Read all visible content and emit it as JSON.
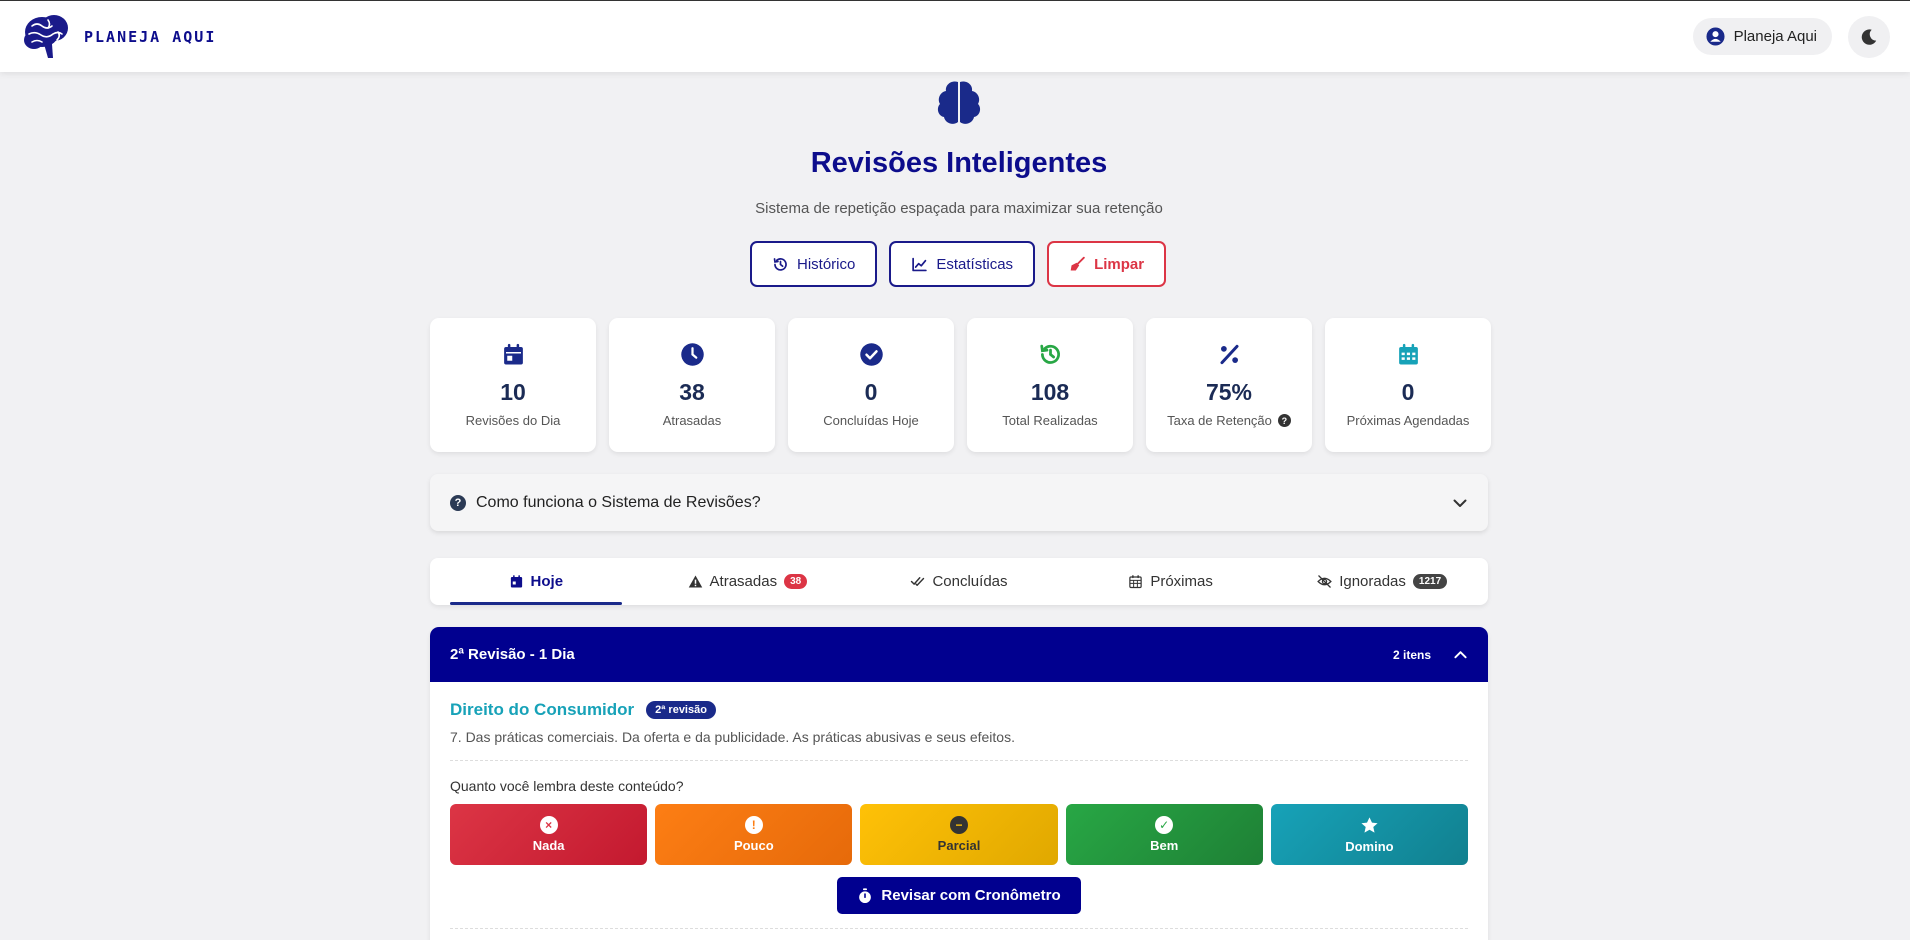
{
  "brand": {
    "name": "PLANEJA AQUI"
  },
  "user": {
    "name": "Planeja Aqui"
  },
  "header": {
    "title": "Revisões Inteligentes",
    "subtitle": "Sistema de repetição espaçada para maximizar sua retenção"
  },
  "actions": {
    "historico": "Histórico",
    "estatisticas": "Estatísticas",
    "limpar": "Limpar"
  },
  "stats": [
    {
      "value": "10",
      "label": "Revisões do Dia",
      "icon": "calendar-icon",
      "color": "#1a2a8a"
    },
    {
      "value": "38",
      "label": "Atrasadas",
      "icon": "clock-icon",
      "color": "#1a2a8a"
    },
    {
      "value": "0",
      "label": "Concluídas Hoje",
      "icon": "check-circle-icon",
      "color": "#1a2a8a"
    },
    {
      "value": "108",
      "label": "Total Realizadas",
      "icon": "history-icon",
      "color": "#28a745"
    },
    {
      "value": "75%",
      "label": "Taxa de Retenção",
      "icon": "percent-icon",
      "color": "#1a2a8a"
    },
    {
      "value": "0",
      "label": "Próximas Agendadas",
      "icon": "calendar-grid-icon",
      "color": "#17a2b8"
    }
  ],
  "accordion": {
    "label": "Como funciona o Sistema de Revisões?"
  },
  "tabs": [
    {
      "label": "Hoje",
      "badge": ""
    },
    {
      "label": "Atrasadas",
      "badge": "38"
    },
    {
      "label": "Concluídas",
      "badge": ""
    },
    {
      "label": "Próximas",
      "badge": ""
    },
    {
      "label": "Ignoradas",
      "badge": "1217"
    }
  ],
  "group": {
    "title": "2ª Revisão - 1 Dia",
    "count": "2 itens",
    "item": {
      "subject": "Direito do Consumidor",
      "badge": "2ª revisão",
      "topic": "7. Das práticas comerciais. Da oferta e da publicidade. As práticas abusivas e seus efeitos.",
      "question": "Quanto você lembra deste conteúdo?",
      "ratings": [
        "Nada",
        "Pouco",
        "Parcial",
        "Bem",
        "Domino"
      ],
      "timer_button": "Revisar com Cronômetro"
    }
  },
  "colors": {
    "primary": "#01008f",
    "danger": "#dc3545",
    "success": "#28a745",
    "info": "#17a2b8",
    "warning": "#ffc107",
    "orange": "#fd7e14"
  }
}
